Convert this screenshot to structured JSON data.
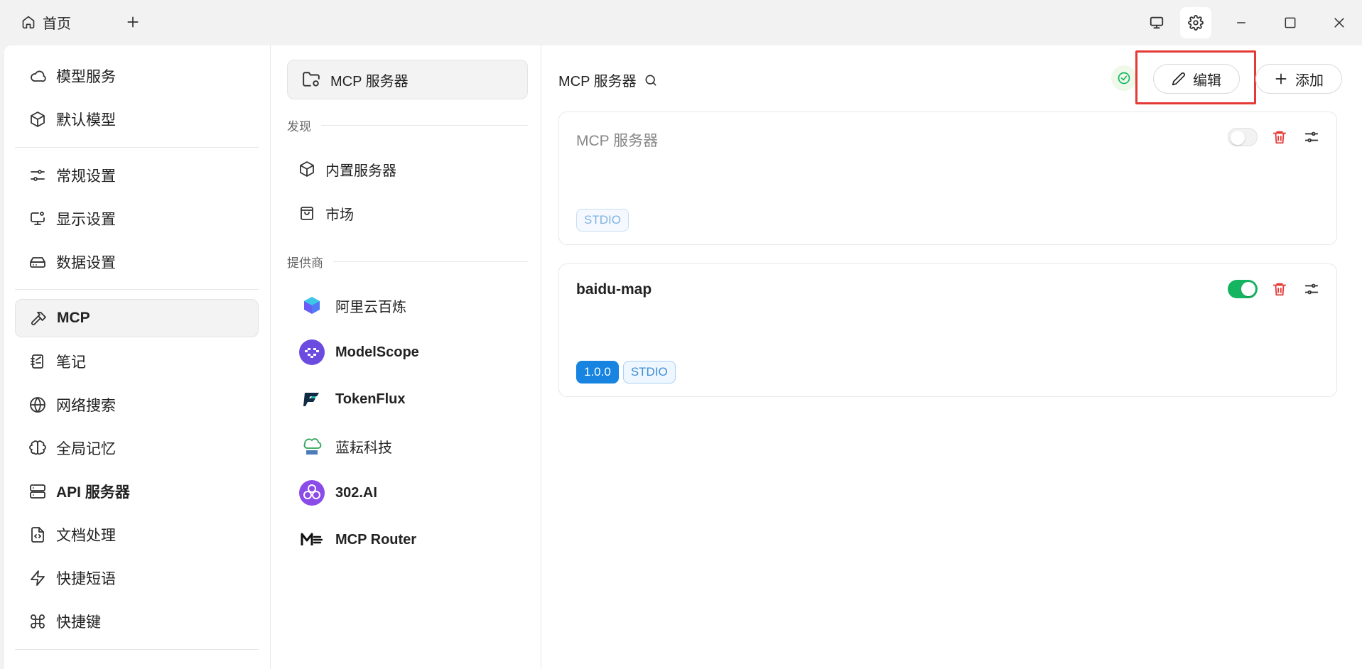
{
  "titlebar": {
    "home_tab_label": "首页",
    "icons": [
      "home-icon",
      "plus-icon",
      "monitor-icon",
      "gear-icon",
      "minimize-icon",
      "maximize-icon",
      "close-icon"
    ]
  },
  "sidebar": {
    "items": [
      {
        "label": "模型服务",
        "icon": "cloud-icon"
      },
      {
        "label": "默认模型",
        "icon": "cube-icon"
      },
      {
        "label": "常规设置",
        "icon": "settings-sliders-icon"
      },
      {
        "label": "显示设置",
        "icon": "display-settings-icon"
      },
      {
        "label": "数据设置",
        "icon": "hard-drive-icon"
      },
      {
        "label": "MCP",
        "icon": "hammer-icon"
      },
      {
        "label": "笔记",
        "icon": "notebook-icon"
      },
      {
        "label": "网络搜索",
        "icon": "globe-icon"
      },
      {
        "label": "全局记忆",
        "icon": "brain-icon"
      },
      {
        "label": "API 服务器",
        "icon": "server-icon"
      },
      {
        "label": "文档处理",
        "icon": "file-code-icon"
      },
      {
        "label": "快捷短语",
        "icon": "zap-icon"
      },
      {
        "label": "快捷键",
        "icon": "command-icon"
      }
    ]
  },
  "midcol": {
    "active_label": "MCP 服务器",
    "discover_label": "发现",
    "discover_items": [
      {
        "label": "内置服务器",
        "icon": "cube-icon"
      },
      {
        "label": "市场",
        "icon": "shopping-bag-icon"
      }
    ],
    "provider_label": "提供商",
    "providers": [
      {
        "label": "阿里云百炼",
        "icon": "bailian-logo-icon"
      },
      {
        "label": "ModelScope",
        "icon": "modelscope-logo-icon"
      },
      {
        "label": "TokenFlux",
        "icon": "tokenflux-logo-icon"
      },
      {
        "label": "蓝耘科技",
        "icon": "lanyun-logo-icon"
      },
      {
        "label": "302.AI",
        "icon": "302ai-logo-icon"
      },
      {
        "label": "MCP Router",
        "icon": "mcp-router-logo-icon"
      }
    ]
  },
  "content": {
    "title": "MCP 服务器",
    "edit_label": "编辑",
    "add_label": "添加",
    "colors": {
      "accent_green": "#15b461",
      "delete_red": "#e53935",
      "tag_blue": "#1684e0",
      "highlight_red": "#e53935"
    },
    "servers": [
      {
        "name": "MCP 服务器",
        "enabled": false,
        "tags": [
          "STDIO"
        ]
      },
      {
        "name": "baidu-map",
        "enabled": true,
        "version": "1.0.0",
        "tags": [
          "STDIO"
        ]
      }
    ]
  }
}
